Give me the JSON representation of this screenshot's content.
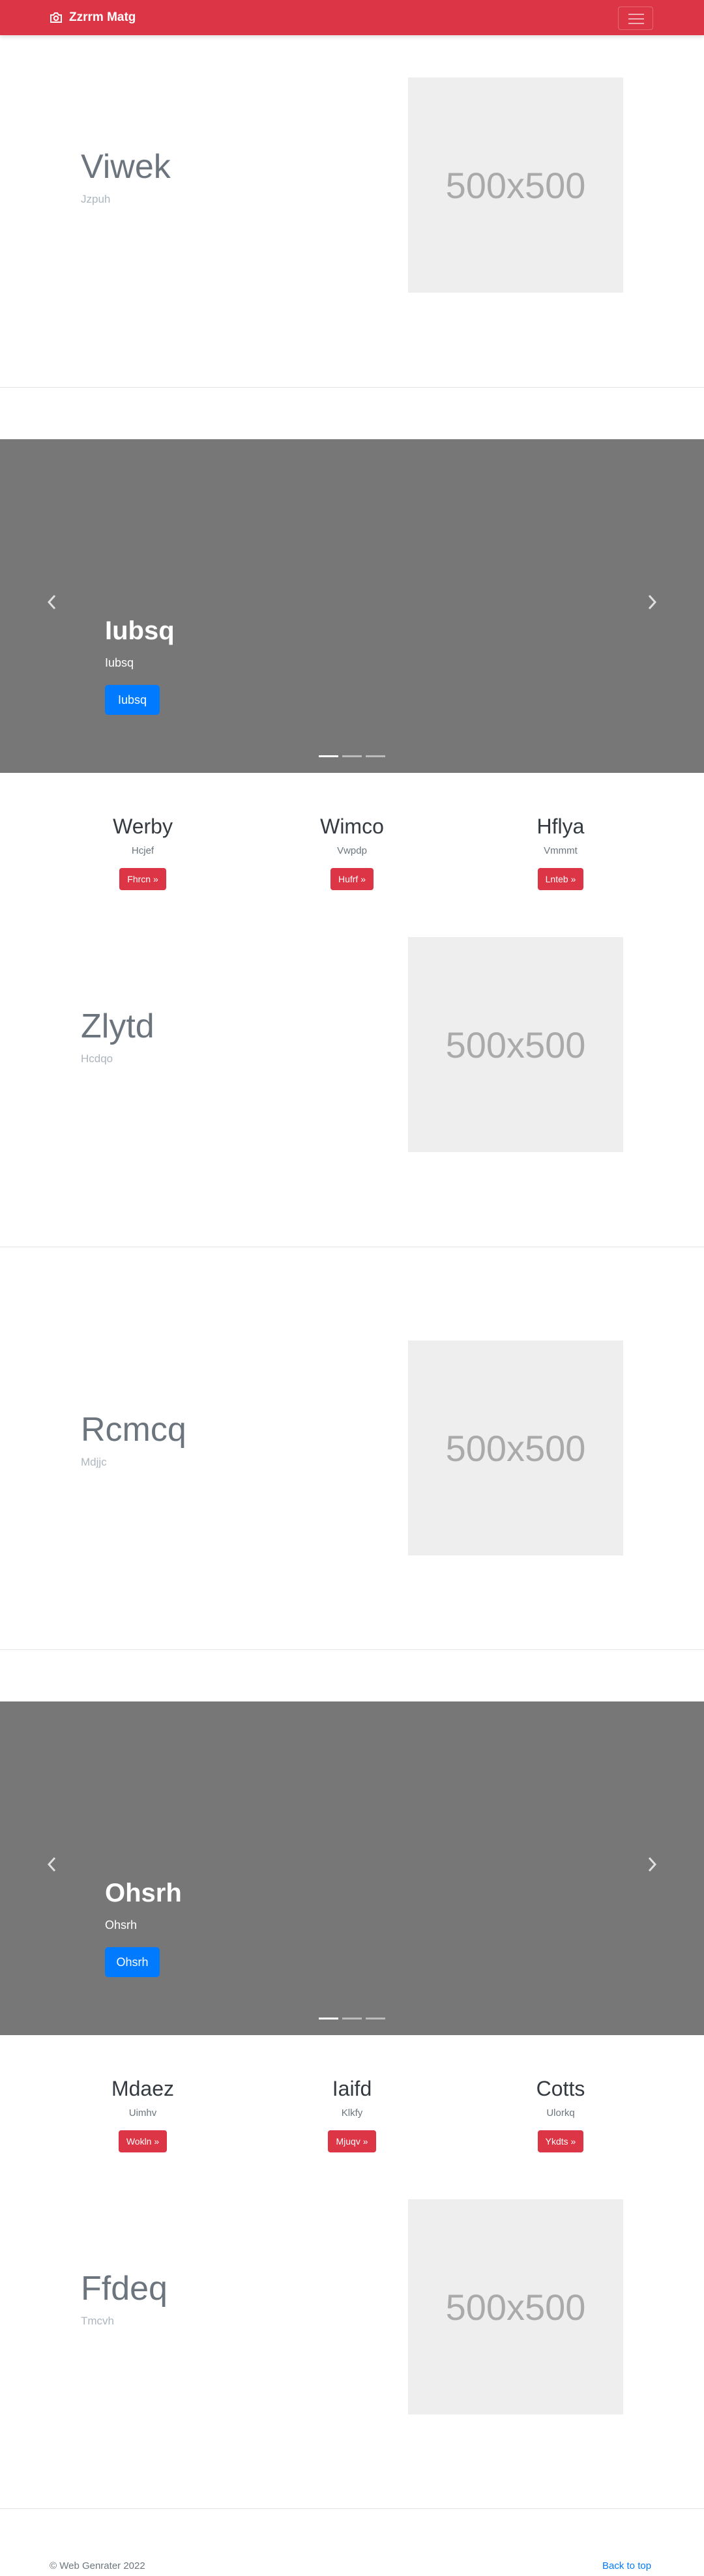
{
  "navbar": {
    "brand": "Zzrrm Matg",
    "brand_icon": "camera-icon",
    "toggler_icon": "hamburger-icon",
    "background": "#dc3545"
  },
  "feature_1": {
    "title": "Viwek",
    "subtitle": "Jzpuh",
    "placeholder": "500x500"
  },
  "carousel_1": {
    "title": "Iubsq",
    "text": "Iubsq",
    "button": "Iubsq",
    "prev_icon": "chevron-left-icon",
    "next_icon": "chevron-right-icon",
    "slides": 3,
    "active": 1
  },
  "columns_1": [
    {
      "heading": "Werby",
      "text": "Hcjef",
      "button": "Fhrcn »"
    },
    {
      "heading": "Wimco",
      "text": "Vwpdp",
      "button": "Hufrf »"
    },
    {
      "heading": "Hflya",
      "text": "Vmmmt",
      "button": "Lnteb »"
    }
  ],
  "feature_2": {
    "title": "Zlytd",
    "subtitle": "Hcdqo",
    "placeholder": "500x500"
  },
  "feature_3": {
    "title": "Rcmcq",
    "subtitle": "Mdjjc",
    "placeholder": "500x500"
  },
  "carousel_2": {
    "title": "Ohsrh",
    "text": "Ohsrh",
    "button": "Ohsrh",
    "prev_icon": "chevron-left-icon",
    "next_icon": "chevron-right-icon",
    "slides": 3,
    "active": 1
  },
  "columns_2": [
    {
      "heading": "Mdaez",
      "text": "Uimhv",
      "button": "Wokln »"
    },
    {
      "heading": "Iaifd",
      "text": "Klkfy",
      "button": "Mjuqv »"
    },
    {
      "heading": "Cotts",
      "text": "Ulorkq",
      "button": "Ykdts »"
    }
  ],
  "feature_4": {
    "title": "Ffdeq",
    "subtitle": "Tmcvh",
    "placeholder": "500x500"
  },
  "footer": {
    "copyright": "© Web Genrater 2022",
    "back_to_top": "Back to top"
  }
}
